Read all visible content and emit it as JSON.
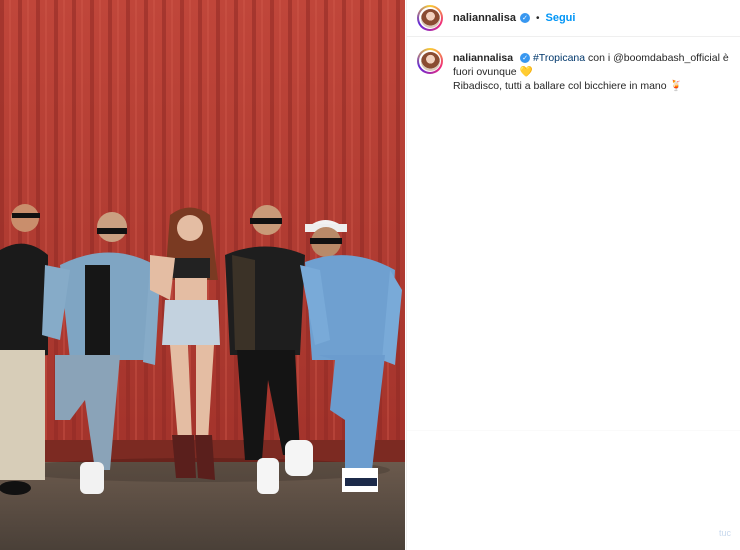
{
  "post": {
    "username": "naliannalisa",
    "follow_label": "Segui",
    "caption": {
      "username": "naliannalisa",
      "hashtag": "#Tropicana",
      "text_mid": " con i ",
      "mention": "@boomdabash_official",
      "text_end": " è fuori ovunque ",
      "emoji1": "💛",
      "line2": "Ribadisco, tutti a ballare col bicchiere in mano ",
      "emoji2": "🍹"
    },
    "faint_text": "tuc"
  },
  "colors": {
    "accent": "#0095f6",
    "hashtag": "#00376b",
    "wall": "#b83a2f"
  },
  "icons": {
    "verified": "verified-badge-icon"
  }
}
